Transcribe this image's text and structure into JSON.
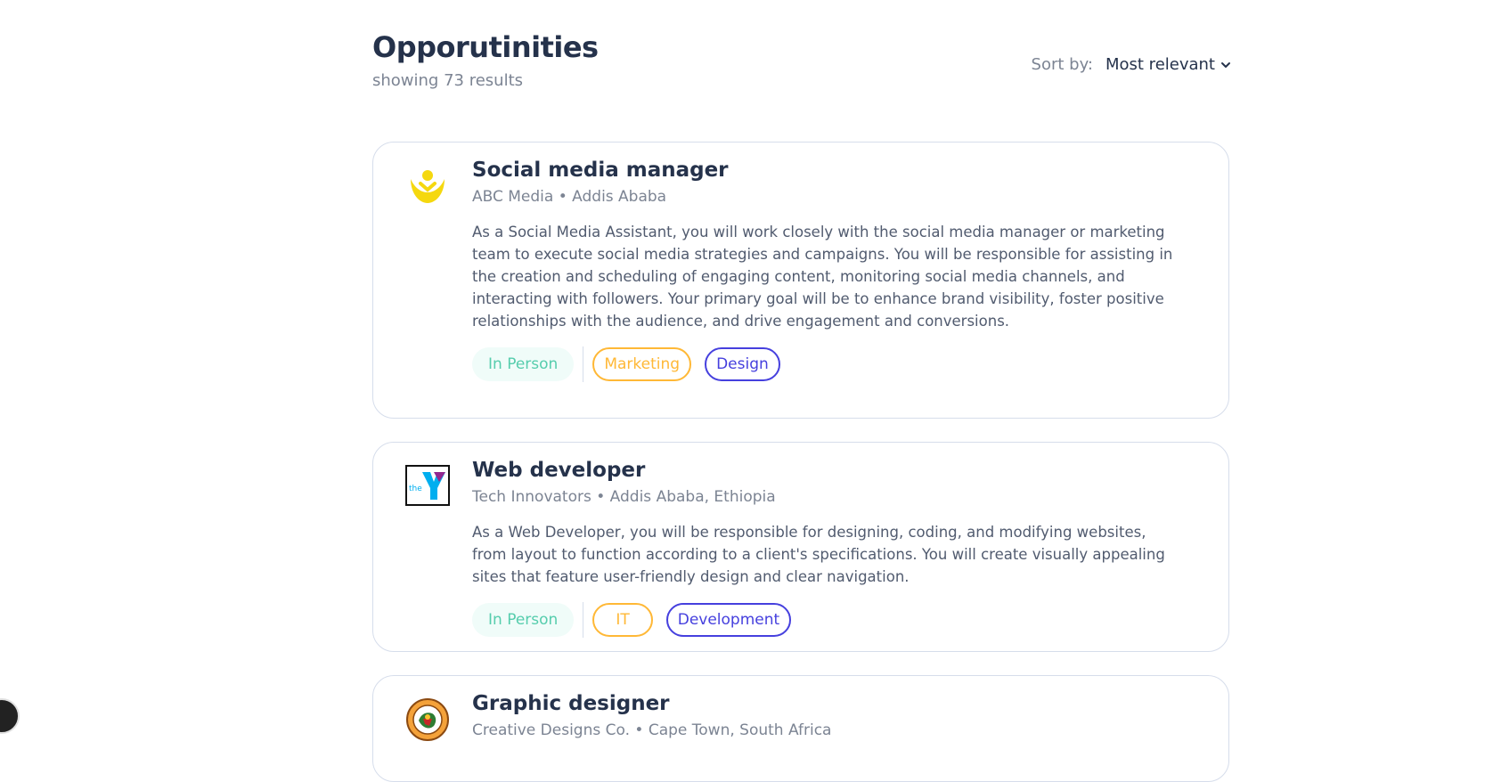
{
  "header": {
    "title": "Opporutinities",
    "subtitle": "showing 73 results",
    "sort_label": "Sort by:",
    "sort_value": "Most relevant"
  },
  "jobs": [
    {
      "title": "Social media manager",
      "meta": "ABC Media • Addis Ababa",
      "description": "As a Social Media Assistant, you will work closely with the social media manager or marketing team to execute social media strategies and campaigns. You will be responsible for assisting in the creation and scheduling of engaging content, monitoring social media channels, and interacting with followers. Your primary goal will be to enhance brand visibility, foster positive relationships with the audience, and drive engagement and conversions.",
      "location_tag": "In Person",
      "categories": [
        "Marketing",
        "Design"
      ],
      "logo_icon": "yellow-person-logo-icon"
    },
    {
      "title": "Web developer",
      "meta": "Tech Innovators • Addis Ababa, Ethiopia",
      "description": "As a Web Developer, you will be responsible for designing, coding, and modifying websites, from layout to function according to a client's specifications. You will create visually appealing sites that feature user-friendly design and clear navigation.",
      "location_tag": "In Person",
      "categories": [
        "IT",
        "Development"
      ],
      "logo_icon": "the-y-logo-icon",
      "logo_text": "the"
    },
    {
      "title": "Graphic designer",
      "meta": "Creative Designs Co. • Cape Town, South Africa",
      "logo_icon": "circular-emblem-logo-icon"
    }
  ],
  "colors": {
    "heading": "#25324B",
    "muted": "#7C8493",
    "body_text": "#515B6F",
    "border": "#D6DDEB",
    "location_bg": "#F0FCF9",
    "location_text": "#56CDAD",
    "cat_yellow": "#FFB836",
    "cat_purple": "#4640DE"
  }
}
